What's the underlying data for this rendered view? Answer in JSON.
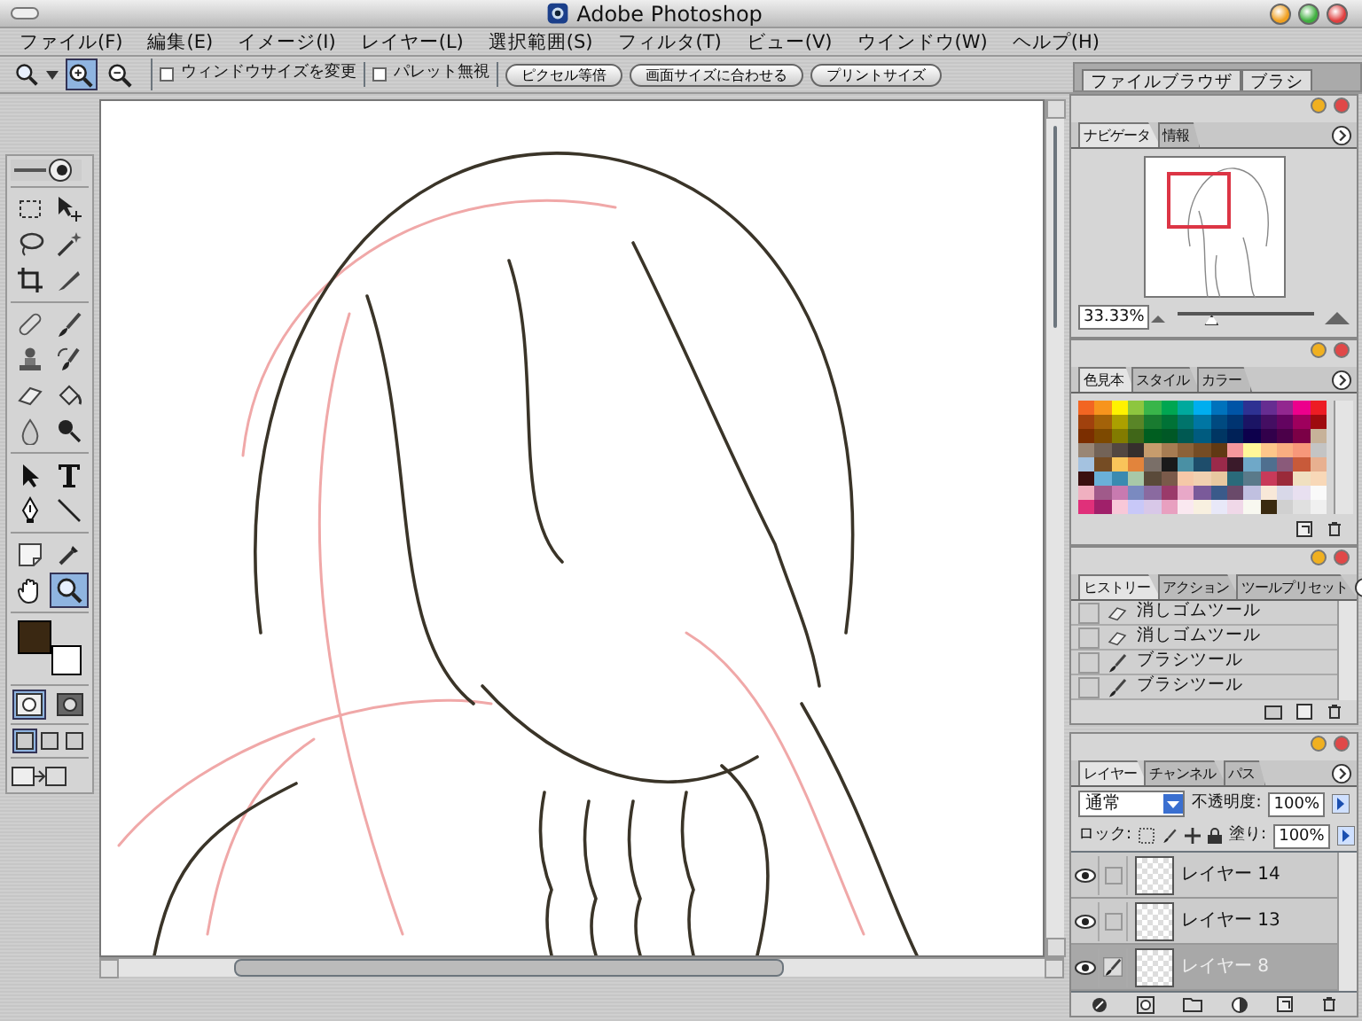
{
  "window": {
    "title": "Adobe Photoshop"
  },
  "menu": [
    "ファイル(F)",
    "編集(E)",
    "イメージ(I)",
    "レイヤー(L)",
    "選択範囲(S)",
    "フィルタ(T)",
    "ビュー(V)",
    "ウインドウ(W)",
    "ヘルプ(H)"
  ],
  "options_bar": {
    "zoom_modes": [
      {
        "kind": "zoom-in",
        "selected": true
      },
      {
        "kind": "zoom-out",
        "selected": false
      }
    ],
    "checkboxes": [
      {
        "label": "ウィンドウサイズを変更",
        "checked": false
      },
      {
        "label": "パレット無視",
        "checked": false
      }
    ],
    "buttons": [
      "ピクセル等倍",
      "画面サイズに合わせる",
      "プリントサイズ"
    ]
  },
  "palette_well": {
    "tabs": [
      "ファイルブラウザ",
      "ブラシ"
    ]
  },
  "toolbox": {
    "tool_groups": [
      {
        "tools": [
          {
            "kind": "marquee",
            "selected": false
          },
          {
            "kind": "move",
            "selected": false
          },
          {
            "kind": "lasso",
            "selected": false
          },
          {
            "kind": "wand",
            "selected": false
          },
          {
            "kind": "crop",
            "selected": false
          },
          {
            "kind": "slice",
            "selected": false
          }
        ]
      },
      {
        "tools": [
          {
            "kind": "healing",
            "selected": false
          },
          {
            "kind": "brush",
            "selected": false
          },
          {
            "kind": "stamp",
            "selected": false
          },
          {
            "kind": "history-brush",
            "selected": false
          },
          {
            "kind": "eraser",
            "selected": false
          },
          {
            "kind": "bucket",
            "selected": false
          },
          {
            "kind": "blur",
            "selected": false
          },
          {
            "kind": "dodge",
            "selected": false
          }
        ]
      },
      {
        "tools": [
          {
            "kind": "path-select",
            "selected": false
          },
          {
            "kind": "type",
            "selected": false
          },
          {
            "kind": "pen",
            "selected": false
          },
          {
            "kind": "line",
            "selected": false
          }
        ]
      },
      {
        "tools": [
          {
            "kind": "notes",
            "selected": false
          },
          {
            "kind": "eyedropper",
            "selected": false
          },
          {
            "kind": "hand",
            "selected": false
          },
          {
            "kind": "zoom",
            "selected": true
          }
        ]
      }
    ],
    "foreground": {
      "color": "#3a2812"
    },
    "background": {
      "color": "#ffffff"
    },
    "mask_modes": [
      {
        "selected": true
      },
      {
        "selected": false
      }
    ],
    "screen_modes": [
      {
        "selected": true
      },
      {
        "selected": false
      },
      {
        "selected": false
      }
    ]
  },
  "navigator": {
    "tabs": [
      {
        "label": "ナビゲータ",
        "selected": true
      },
      {
        "label": "情報",
        "selected": false
      }
    ],
    "zoom": "33.33%",
    "zoom_slider": {
      "level": 0.25
    }
  },
  "swatches": {
    "tabs": [
      {
        "label": "色見本",
        "selected": true
      },
      {
        "label": "スタイル",
        "selected": false
      },
      {
        "label": "カラー",
        "selected": false
      }
    ],
    "rows": [
      {
        "cells": [
          {
            "color": "#f26522"
          },
          {
            "color": "#f7941d"
          },
          {
            "color": "#fff200"
          },
          {
            "color": "#8dc63f"
          },
          {
            "color": "#39b54a"
          },
          {
            "color": "#00a651"
          },
          {
            "color": "#00a99d"
          },
          {
            "color": "#00aeef"
          },
          {
            "color": "#0072bc"
          },
          {
            "color": "#0054a6"
          },
          {
            "color": "#2e3192"
          },
          {
            "color": "#662d91"
          },
          {
            "color": "#92278f"
          },
          {
            "color": "#ec008c"
          },
          {
            "color": "#ed1c24"
          }
        ]
      },
      {
        "cells": [
          {
            "color": "#a0410d"
          },
          {
            "color": "#a36209"
          },
          {
            "color": "#aba000"
          },
          {
            "color": "#598527"
          },
          {
            "color": "#197b30"
          },
          {
            "color": "#007236"
          },
          {
            "color": "#00746b"
          },
          {
            "color": "#0076a3"
          },
          {
            "color": "#004a80"
          },
          {
            "color": "#003471"
          },
          {
            "color": "#1b1464"
          },
          {
            "color": "#440e62"
          },
          {
            "color": "#630460"
          },
          {
            "color": "#9e005d"
          },
          {
            "color": "#9e0b0f"
          }
        ]
      },
      {
        "cells": [
          {
            "color": "#7b2e00"
          },
          {
            "color": "#7d4900"
          },
          {
            "color": "#827b00"
          },
          {
            "color": "#406618"
          },
          {
            "color": "#005e20"
          },
          {
            "color": "#005826"
          },
          {
            "color": "#005952"
          },
          {
            "color": "#005b7f"
          },
          {
            "color": "#003663"
          },
          {
            "color": "#002157"
          },
          {
            "color": "#0d004c"
          },
          {
            "color": "#32004b"
          },
          {
            "color": "#4b0049"
          },
          {
            "color": "#7b0046"
          },
          {
            "color": "#c7b299"
          }
        ]
      },
      {
        "cells": [
          {
            "color": "#998675"
          },
          {
            "color": "#736357"
          },
          {
            "color": "#534741"
          },
          {
            "color": "#362f2d"
          },
          {
            "color": "#c69c6d"
          },
          {
            "color": "#a67c52"
          },
          {
            "color": "#8c6239"
          },
          {
            "color": "#754c24"
          },
          {
            "color": "#603913"
          },
          {
            "color": "#f5989d"
          },
          {
            "color": "#fff799"
          },
          {
            "color": "#fdc68a"
          },
          {
            "color": "#f9ad81"
          },
          {
            "color": "#f7977a"
          },
          {
            "color": "#c4c4c4"
          }
        ]
      },
      {
        "cells": [
          {
            "color": "#a4c2e0"
          },
          {
            "color": "#754c24"
          },
          {
            "color": "#f9c45a"
          },
          {
            "color": "#e2843c"
          },
          {
            "color": "#7a6f68"
          },
          {
            "color": "#1a1a1a"
          },
          {
            "color": "#4a90a4"
          },
          {
            "color": "#1e4d6b"
          },
          {
            "color": "#9a2a4a"
          },
          {
            "color": "#3a1a2a"
          },
          {
            "color": "#6fa8c8"
          },
          {
            "color": "#4f6f8f"
          },
          {
            "color": "#8a5a7a"
          },
          {
            "color": "#c85a3a"
          },
          {
            "color": "#e8b090"
          }
        ]
      },
      {
        "cells": [
          {
            "color": "#3a1010"
          },
          {
            "color": "#6ab0d8"
          },
          {
            "color": "#3a8ab0"
          },
          {
            "color": "#a8c8a8"
          },
          {
            "color": "#5a4a3a"
          },
          {
            "color": "#7a5a4a"
          },
          {
            "color": "#f5c8a8"
          },
          {
            "color": "#f0d0b0"
          },
          {
            "color": "#e8c8a0"
          },
          {
            "color": "#2a6a7a"
          },
          {
            "color": "#5a7a8a"
          },
          {
            "color": "#c83a5a"
          },
          {
            "color": "#9a2a3a"
          },
          {
            "color": "#f0e0c0"
          },
          {
            "color": "#f8d8b8"
          }
        ]
      },
      {
        "cells": [
          {
            "color": "#f0b0c0"
          },
          {
            "color": "#a05a8a"
          },
          {
            "color": "#c87ab0"
          },
          {
            "color": "#7a8ac0"
          },
          {
            "color": "#8a6aa0"
          },
          {
            "color": "#9a3a6a"
          },
          {
            "color": "#e8a8c8"
          },
          {
            "color": "#7a5a9a"
          },
          {
            "color": "#3a5a8a"
          },
          {
            "color": "#6a4a6a"
          },
          {
            "color": "#c0c0e0"
          },
          {
            "color": "#f8e8d8"
          },
          {
            "color": "#d8d8e8"
          },
          {
            "color": "#e8e0f0"
          },
          {
            "color": "#fafafa"
          }
        ]
      },
      {
        "cells": [
          {
            "color": "#e0307a"
          },
          {
            "color": "#a0206a"
          },
          {
            "color": "#f8c8d8"
          },
          {
            "color": "#c8c8f8"
          },
          {
            "color": "#d8c8e8"
          },
          {
            "color": "#e8a0c0"
          },
          {
            "color": "#fae8f0"
          },
          {
            "color": "#f8f0e0"
          },
          {
            "color": "#e8e8f8"
          },
          {
            "color": "#f0d8e8"
          },
          {
            "color": "#f8f8f0"
          },
          {
            "color": "#3a2a10"
          },
          {
            "color": "#d0d0d0"
          },
          {
            "color": "#e0e0e0"
          },
          {
            "color": "#f0f0f0"
          }
        ]
      }
    ]
  },
  "history": {
    "tabs": [
      {
        "label": "ヒストリー",
        "selected": true
      },
      {
        "label": "アクション",
        "selected": false
      },
      {
        "label": "ツールプリセット",
        "selected": false
      }
    ],
    "items": [
      {
        "kind": "eraser",
        "label": "消しゴムツール"
      },
      {
        "kind": "eraser",
        "label": "消しゴムツール"
      },
      {
        "kind": "brush",
        "label": "ブラシツール"
      },
      {
        "kind": "brush",
        "label": "ブラシツール"
      }
    ]
  },
  "layers": {
    "tabs": [
      {
        "label": "レイヤー",
        "selected": true
      },
      {
        "label": "チャンネル",
        "selected": false
      },
      {
        "label": "パス",
        "selected": false
      }
    ],
    "blend_mode": "通常",
    "opacity_label": "不透明度:",
    "opacity": "100%",
    "lock_label": "ロック:",
    "fill_label": "塗り:",
    "fill": "100%",
    "items": [
      {
        "name": "レイヤー 14",
        "visible": true,
        "selected": false,
        "brush_linked": false
      },
      {
        "name": "レイヤー 13",
        "visible": true,
        "selected": false,
        "brush_linked": false
      },
      {
        "name": "レイヤー 8",
        "visible": true,
        "selected": true,
        "brush_linked": true
      }
    ]
  }
}
